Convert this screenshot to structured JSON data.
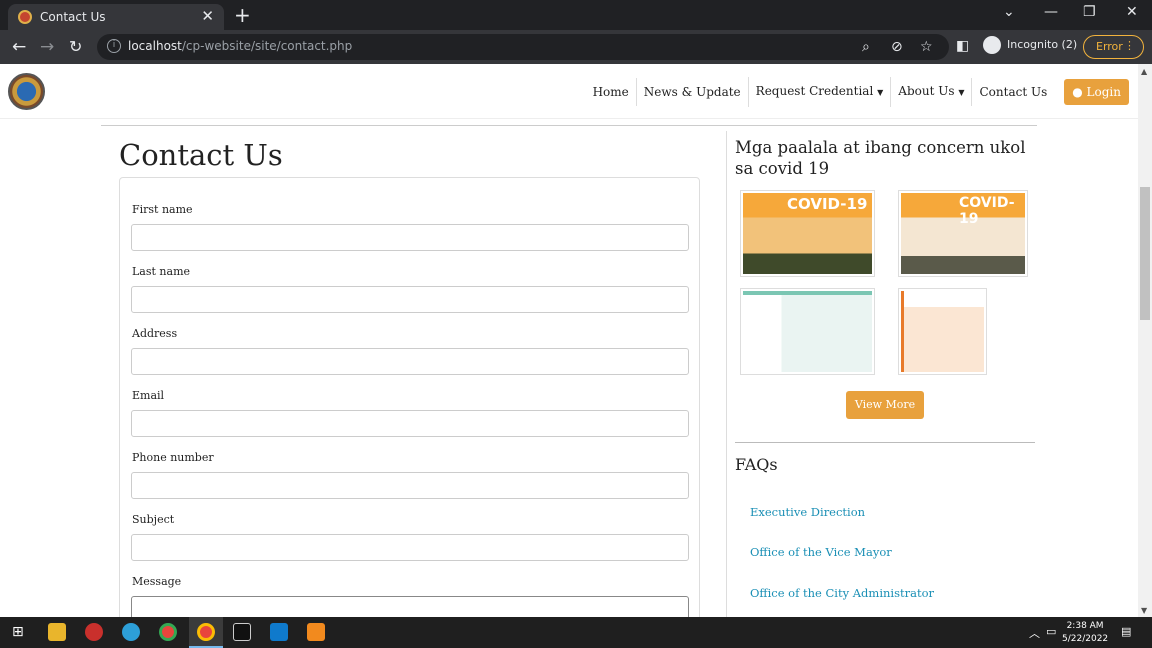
{
  "browser": {
    "tab_title": "Contact Us",
    "tab_close": "✕",
    "new_tab": "+",
    "url_host": "localhost",
    "url_path": "/cp-website/site/contact.php",
    "incognito_label": "Incognito (2)",
    "error_label": "Error"
  },
  "nav": {
    "items": [
      {
        "label": "Home"
      },
      {
        "label": "News & Update"
      },
      {
        "label": "Request Credential",
        "caret": true
      },
      {
        "label": "About Us",
        "caret": true
      },
      {
        "label": "Contact Us"
      }
    ],
    "login_label": "Login"
  },
  "form": {
    "page_title": "Contact Us",
    "fields": [
      {
        "label": "First name",
        "value": ""
      },
      {
        "label": "Last name",
        "value": ""
      },
      {
        "label": "Address",
        "value": ""
      },
      {
        "label": "Email",
        "value": ""
      },
      {
        "label": "Phone number",
        "value": ""
      },
      {
        "label": "Subject",
        "value": ""
      },
      {
        "label": "Message",
        "value": ""
      }
    ]
  },
  "sidebar": {
    "title": "Mga paalala at ibang concern ukol sa covid 19",
    "thumb_heading": "COVID-19",
    "view_more": "View More",
    "faq_title": "FAQs",
    "faq_links": [
      {
        "label": "Executive Direction"
      },
      {
        "label": "Office of the Vice Mayor"
      },
      {
        "label": "Office of the City Administrator"
      }
    ]
  },
  "taskbar": {
    "time": "2:38 AM",
    "date": "5/22/2022"
  },
  "colors": {
    "accent": "#e8a13d",
    "link": "#1a8fb5",
    "chrome_dark": "#202124"
  }
}
